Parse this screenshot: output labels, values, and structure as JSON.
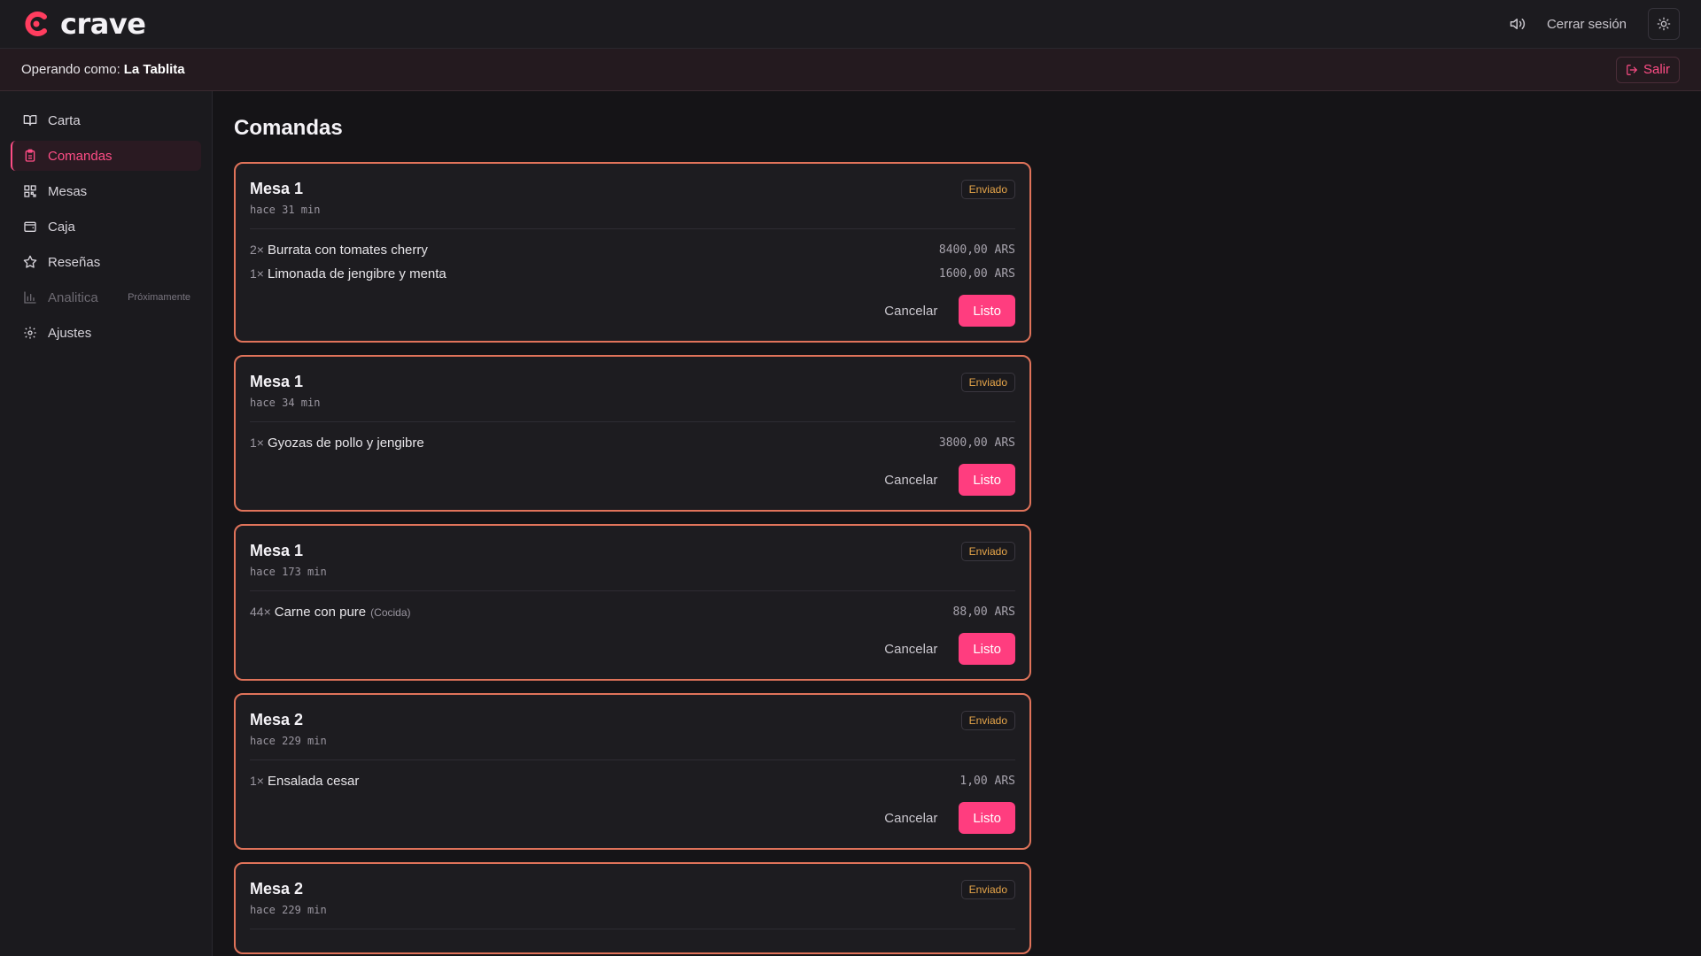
{
  "header": {
    "brand": "crave",
    "logout_label": "Cerrar sesión",
    "icons": {
      "sound": "speaker-icon",
      "theme": "sun-icon"
    }
  },
  "operating": {
    "label": "Operando como:",
    "name": "La Tablita",
    "exit_label": "Salir"
  },
  "sidebar": {
    "items": [
      {
        "label": "Carta",
        "icon": "book-icon"
      },
      {
        "label": "Comandas",
        "icon": "clipboard-icon",
        "active": true
      },
      {
        "label": "Mesas",
        "icon": "qr-grid-icon"
      },
      {
        "label": "Caja",
        "icon": "wallet-icon"
      },
      {
        "label": "Reseñas",
        "icon": "star-icon"
      },
      {
        "label": "Analitica",
        "icon": "bar-chart-icon",
        "badge": "Próximamente",
        "disabled": true
      },
      {
        "label": "Ajustes",
        "icon": "gear-icon"
      }
    ]
  },
  "main": {
    "title": "Comandas",
    "cancel_label": "Cancelar",
    "ready_label": "Listo",
    "orders": [
      {
        "table": "Mesa 1",
        "time": "hace 31 min",
        "status": "Enviado",
        "items": [
          {
            "qty": "2×",
            "name": "Burrata con tomates cherry",
            "note": "",
            "price": "8400,00 ARS"
          },
          {
            "qty": "1×",
            "name": "Limonada de jengibre y menta",
            "note": "",
            "price": "1600,00 ARS"
          }
        ]
      },
      {
        "table": "Mesa 1",
        "time": "hace 34 min",
        "status": "Enviado",
        "items": [
          {
            "qty": "1×",
            "name": "Gyozas de pollo y jengibre",
            "note": "",
            "price": "3800,00 ARS"
          }
        ]
      },
      {
        "table": "Mesa 1",
        "time": "hace 173 min",
        "status": "Enviado",
        "items": [
          {
            "qty": "44×",
            "name": "Carne con pure",
            "note": "(Cocida)",
            "price": "88,00 ARS"
          }
        ]
      },
      {
        "table": "Mesa 2",
        "time": "hace 229 min",
        "status": "Enviado",
        "items": [
          {
            "qty": "1×",
            "name": "Ensalada cesar",
            "note": "",
            "price": "1,00 ARS"
          }
        ]
      },
      {
        "table": "Mesa 2",
        "time": "hace 229 min",
        "status": "Enviado",
        "items": []
      }
    ]
  },
  "colors": {
    "accent": "#ff3d7f",
    "card_border": "#e0735a",
    "status": "#e8a64a",
    "background": "#151417"
  }
}
